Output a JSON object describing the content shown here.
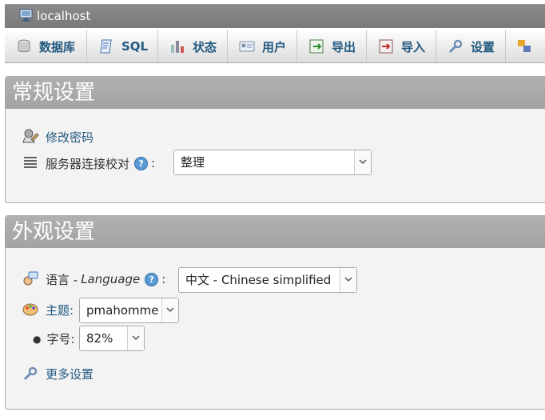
{
  "topbar": {
    "host": "localhost",
    "icon": "server-icon"
  },
  "tabs": [
    {
      "label": "数据库",
      "icon": "database-icon"
    },
    {
      "label": "SQL",
      "icon": "sql-icon"
    },
    {
      "label": "状态",
      "icon": "status-icon"
    },
    {
      "label": "用户",
      "icon": "users-icon"
    },
    {
      "label": "导出",
      "icon": "export-icon"
    },
    {
      "label": "导入",
      "icon": "import-icon"
    },
    {
      "label": "设置",
      "icon": "settings-icon"
    },
    {
      "label": "",
      "icon": "replication-icon"
    }
  ],
  "general": {
    "title": "常规设置",
    "change_password": "修改密码",
    "collation_label": "服务器连接校对",
    "collation_value": "整理",
    "colon": ":"
  },
  "appearance": {
    "title": "外观设置",
    "language_label": "语言 - ",
    "language_en": "Language",
    "language_value": "中文 - Chinese simplified",
    "theme_label": "主题:",
    "theme_value": "pmahomme",
    "fontsize_label": "字号:",
    "fontsize_value": "82%",
    "more_settings": "更多设置",
    "colon": ":"
  }
}
